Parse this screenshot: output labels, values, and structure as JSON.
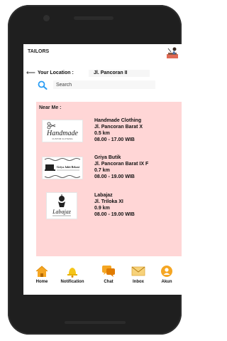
{
  "app": {
    "title": "TAILORS",
    "logo_icon": "tailor-logo-icon"
  },
  "location": {
    "back_icon": "back-arrow-icon",
    "label": "Your Location :",
    "value": "Jl. Pancoran II"
  },
  "search": {
    "icon": "search-icon",
    "placeholder": "Search"
  },
  "near": {
    "title": "Near Me :",
    "shops": [
      {
        "name": "Handmade Clothing",
        "address": "Jl. Pancoran Barat X",
        "distance": "0.5 km",
        "hours": "08.00 - 17.00 WIB",
        "logo_text": "Handmade",
        "logo_subtext": "CUSTOM CLOTHING"
      },
      {
        "name": "Griya Butik",
        "address": "Jl. Pancoran Barat IX F",
        "distance": "0.7 km",
        "hours": "08.00 - 19.00 WIB",
        "logo_text": "Griya Jahit Bekasi",
        "logo_subtext": ""
      },
      {
        "name": "Labajaz",
        "address": "Jl. Triloka XI",
        "distance": "0.9 km",
        "hours": "08.00 - 19.00 WIB",
        "logo_text": "Labajaz",
        "logo_subtext": ""
      }
    ]
  },
  "nav": [
    {
      "label": "Home",
      "icon": "home-icon"
    },
    {
      "label": "Notification",
      "icon": "bell-icon"
    },
    {
      "label": "Chat",
      "icon": "chat-icon"
    },
    {
      "label": "Inbox",
      "icon": "mail-icon"
    },
    {
      "label": "Akun",
      "icon": "account-icon"
    }
  ],
  "colors": {
    "panel": "#ffd6d6",
    "nav_accent": "#f5a623",
    "search_icon": "#2a9df4"
  }
}
